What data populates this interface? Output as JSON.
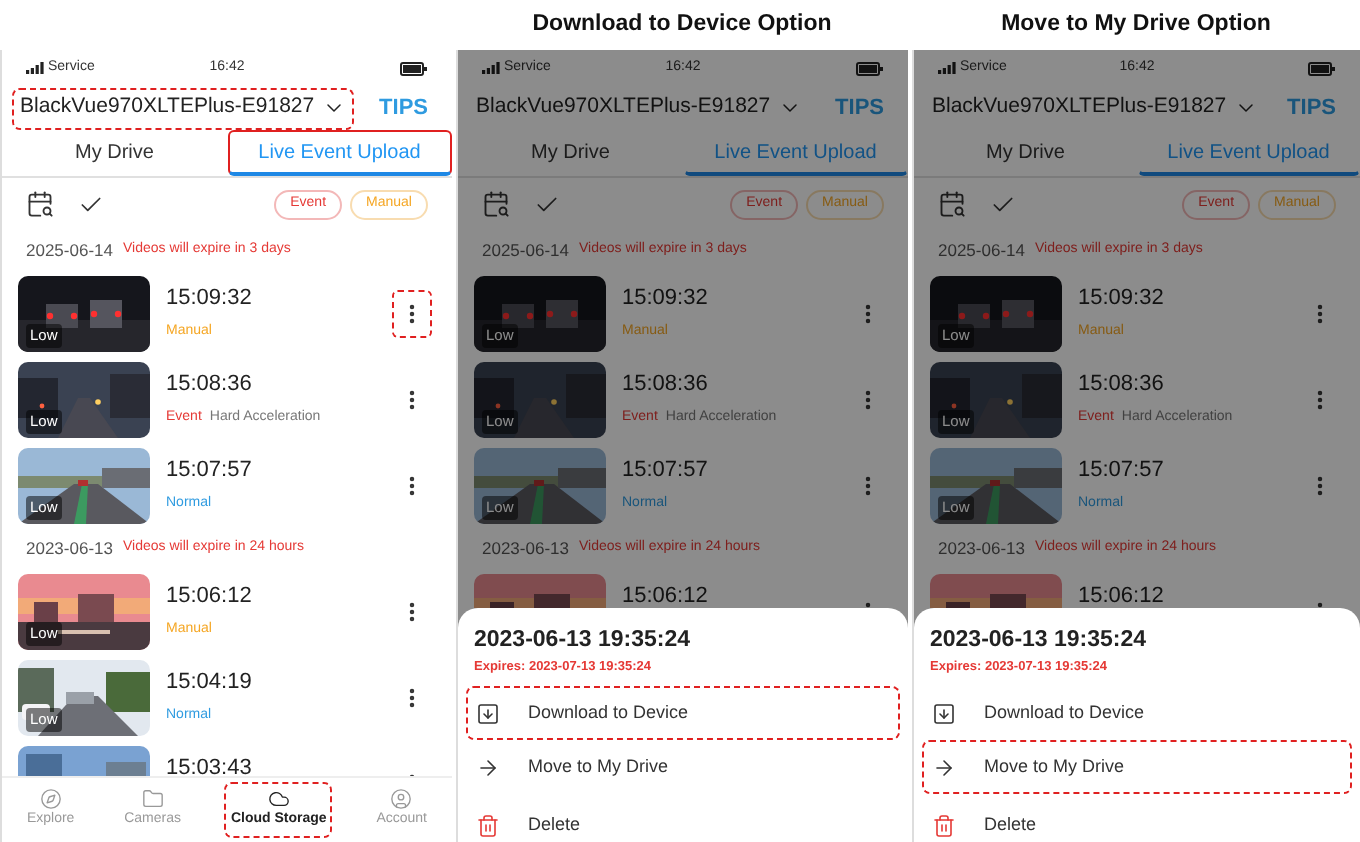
{
  "panels": [
    {
      "phone": {
        "status": {
          "carrier": "Service",
          "time": "16:42"
        },
        "device": {
          "name": "BlackVue970XLTEPlus-E91827",
          "highlighted": true
        },
        "tips": "TIPS",
        "tabs": [
          {
            "label": "My Drive",
            "selected": false,
            "highlighted": false
          },
          {
            "label": "Live Event Upload",
            "selected": true,
            "highlighted": true
          }
        ],
        "filters": [
          {
            "label": "Event",
            "kind": "event"
          },
          {
            "label": "Manual",
            "kind": "manual"
          }
        ],
        "groups": [
          {
            "date": "2025-06-14",
            "note": "Videos will expire in 3 days",
            "clips": [
              {
                "time": "15:09:32",
                "quality": "Low",
                "tag": "Manual",
                "kind": "manual",
                "menu_highlighted": true
              },
              {
                "time": "15:08:36",
                "quality": "Low",
                "tag": "Event",
                "kind": "event",
                "reason": "Hard Acceleration",
                "menu_highlighted": false
              },
              {
                "time": "15:07:57",
                "quality": "Low",
                "tag": "Normal",
                "kind": "normal",
                "menu_highlighted": false
              }
            ]
          },
          {
            "date": "2023-06-13",
            "note": "Videos will expire in 24 hours",
            "clips": [
              {
                "time": "15:06:12",
                "quality": "Low",
                "tag": "Manual",
                "kind": "manual",
                "menu_highlighted": false
              },
              {
                "time": "15:04:19",
                "quality": "Low",
                "tag": "Normal",
                "kind": "normal",
                "menu_highlighted": false
              },
              {
                "time": "15:03:43",
                "menu_highlighted": false
              }
            ]
          }
        ],
        "nav": [
          {
            "label": "Explore",
            "kind": "explore",
            "selected": false,
            "highlighted": false
          },
          {
            "label": "Cameras",
            "kind": "cameras",
            "selected": false,
            "highlighted": false
          },
          {
            "label": "Cloud Storage",
            "kind": "cloud",
            "selected": true,
            "highlighted": true
          },
          {
            "label": "Account",
            "kind": "account",
            "selected": false,
            "highlighted": false
          }
        ]
      }
    },
    {
      "caption": "Download to Device Option",
      "phone": {
        "status": {
          "carrier": "Service",
          "time": "16:42"
        },
        "device": {
          "name": "BlackVue970XLTEPlus-E91827",
          "highlighted": false
        },
        "tips": "TIPS",
        "tabs": [
          {
            "label": "My Drive",
            "selected": false,
            "highlighted": false
          },
          {
            "label": "Live Event Upload",
            "selected": true,
            "highlighted": false
          }
        ],
        "filters": [
          {
            "label": "Event",
            "kind": "event"
          },
          {
            "label": "Manual",
            "kind": "manual"
          }
        ],
        "groups": [
          {
            "date": "2025-06-14",
            "note": "Videos will expire in 3 days",
            "clips": [
              {
                "time": "15:09:32",
                "quality": "Low",
                "tag": "Manual",
                "kind": "manual",
                "menu_highlighted": false
              },
              {
                "time": "15:08:36",
                "quality": "Low",
                "tag": "Event",
                "kind": "event",
                "reason": "Hard Acceleration",
                "menu_highlighted": false
              },
              {
                "time": "15:07:57",
                "quality": "Low",
                "tag": "Normal",
                "kind": "normal",
                "menu_highlighted": false
              }
            ]
          },
          {
            "date": "2023-06-13",
            "note": "Videos will expire in 24 hours",
            "clips": [
              {
                "time": "15:06:12",
                "menu_highlighted": false
              }
            ]
          }
        ]
      },
      "sheet": {
        "title": "2023-06-13 19:35:24",
        "expires": "Expires: 2023-07-13 19:35:24",
        "actions": [
          {
            "label": "Download to Device",
            "kind": "download",
            "highlighted": true
          },
          {
            "label": "Move to My Drive",
            "kind": "move",
            "highlighted": false
          },
          {
            "label": "Delete",
            "kind": "delete",
            "highlighted": false
          }
        ]
      }
    },
    {
      "caption": "Move to My Drive Option",
      "phone": {
        "status": {
          "carrier": "Service",
          "time": "16:42"
        },
        "device": {
          "name": "BlackVue970XLTEPlus-E91827",
          "highlighted": false
        },
        "tips": "TIPS",
        "tabs": [
          {
            "label": "My Drive",
            "selected": false,
            "highlighted": false
          },
          {
            "label": "Live Event Upload",
            "selected": true,
            "highlighted": false
          }
        ],
        "filters": [
          {
            "label": "Event",
            "kind": "event"
          },
          {
            "label": "Manual",
            "kind": "manual"
          }
        ],
        "groups": [
          {
            "date": "2025-06-14",
            "note": "Videos will expire in 3 days",
            "clips": [
              {
                "time": "15:09:32",
                "quality": "Low",
                "tag": "Manual",
                "kind": "manual",
                "menu_highlighted": false
              },
              {
                "time": "15:08:36",
                "quality": "Low",
                "tag": "Event",
                "kind": "event",
                "reason": "Hard Acceleration",
                "menu_highlighted": false
              },
              {
                "time": "15:07:57",
                "quality": "Low",
                "tag": "Normal",
                "kind": "normal",
                "menu_highlighted": false
              }
            ]
          },
          {
            "date": "2023-06-13",
            "note": "Videos will expire in 24 hours",
            "clips": [
              {
                "time": "15:06:12",
                "menu_highlighted": false
              }
            ]
          }
        ]
      },
      "sheet": {
        "title": "2023-06-13 19:35:24",
        "expires": "Expires: 2023-07-13 19:35:24",
        "actions": [
          {
            "label": "Download to Device",
            "kind": "download",
            "highlighted": false
          },
          {
            "label": "Move to My Drive",
            "kind": "move",
            "highlighted": true
          },
          {
            "label": "Delete",
            "kind": "delete",
            "highlighted": false
          }
        ]
      }
    }
  ]
}
